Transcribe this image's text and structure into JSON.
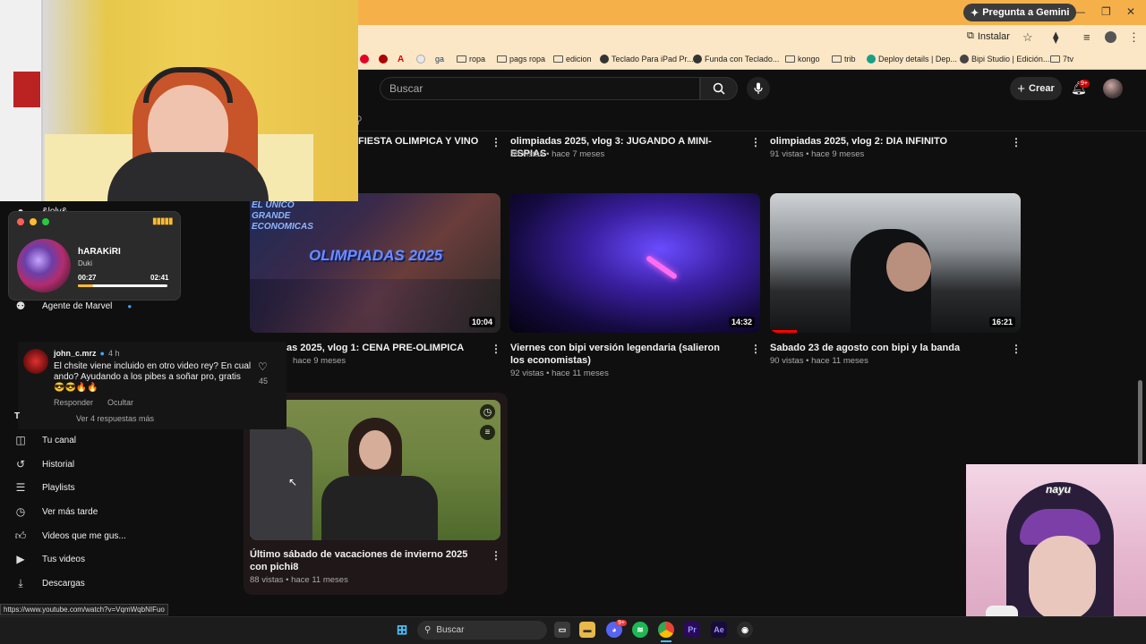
{
  "browser": {
    "gemini_label": "Pregunta a Gemini",
    "install_label": "Instalar",
    "bookmarks": [
      "ropa",
      "pags ropa",
      "edicion",
      "Teclado Para iPad Pr...",
      "Funda con Teclado...",
      "kongo",
      "trib",
      "Deploy details | Dep...",
      "Bipi Studio | Edición...",
      "7tv"
    ]
  },
  "header": {
    "search_placeholder": "Buscar",
    "create_label": "Crear",
    "notifications_badge": "9+"
  },
  "videos": [
    {
      "title": "FIESTA OLIMPICA Y VINO",
      "meta": ""
    },
    {
      "title": "olimpiadas 2025, vlog 3: JUGANDO A MINI-ESPIAS",
      "meta": "58 vistas • hace 7 meses"
    },
    {
      "title": "olimpiadas 2025, vlog 2: DIA INFINITO",
      "meta": "91 vistas • hace 9 meses"
    },
    {
      "title": "as 2025, vlog 1: CENA PRE-OLIMPICA",
      "meta": "hace 9 meses",
      "duration": "10:04",
      "thumb_text": "OLIMPIADAS 2025",
      "thumb_sub": "EL UNICO GRANDE ECONOMICAS"
    },
    {
      "title": "Viernes con bipi versión legendaria (salieron los economistas)",
      "meta": "92 vistas • hace 11 meses",
      "duration": "14:32"
    },
    {
      "title": "Sabado 23 de agosto con bipi y la banda",
      "meta": "90 vistas • hace 11 meses",
      "duration": "16:21"
    },
    {
      "title": "Último sábado de vacaciones de invierno 2025 con pichi8",
      "meta": "88 vistas • hace 11 meses"
    }
  ],
  "sidebar": {
    "top_partial": "&lolv&",
    "agent": "Agente de Marvel",
    "items": [
      "Tu canal",
      "Historial",
      "Playlists",
      "Ver más tarde",
      "Videos que me gus...",
      "Tus videos",
      "Descargas"
    ]
  },
  "player": {
    "track": "hARAKiRI",
    "artist": "Duki",
    "elapsed": "00:27",
    "total": "02:41",
    "progress": 0.17
  },
  "comment": {
    "author": "john_c.mrz",
    "age": "4 h",
    "text": "El chsite viene incluido en otro video rey? En cual ando? Ayudando a los pibes a soñar pro, gratis 😎😎🔥🔥",
    "likes": "45",
    "reply": "Responder",
    "hide": "Ocultar",
    "more": "Ver 4 respuestas más"
  },
  "status_url": "https://www.youtube.com/watch?v=VqmWqbNIFuo",
  "taskbar": {
    "search": "Buscar",
    "discord_badge": "9+"
  },
  "overlay": {
    "name": "nayu"
  }
}
